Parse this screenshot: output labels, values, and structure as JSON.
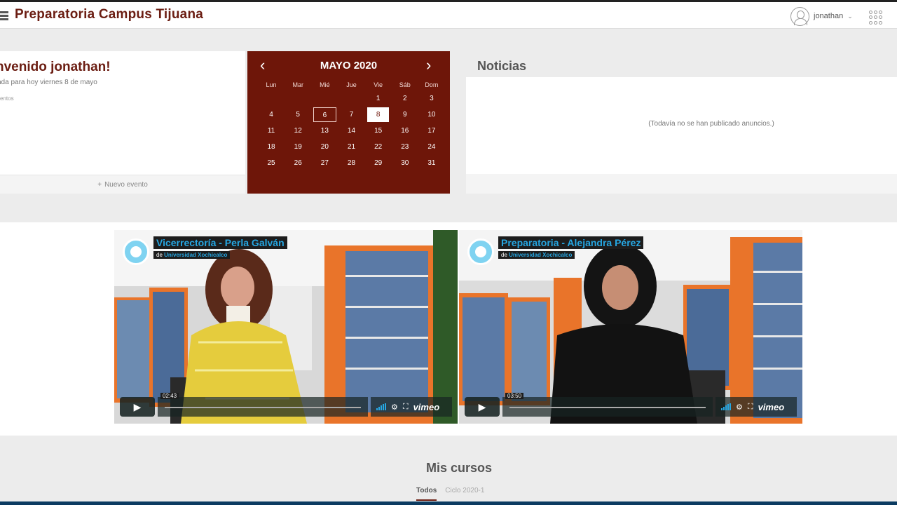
{
  "header": {
    "title": "Preparatoria Campus Tijuana",
    "user": "jonathan",
    "user_chevron": "⌄"
  },
  "welcome": {
    "title": "nvenido jonathan!",
    "subtitle": "nda para hoy viernes 8 de mayo",
    "no_events": "ventos",
    "new_event": "Nuevo evento",
    "new_event_icon": "+"
  },
  "calendar": {
    "title": "MAYO 2020",
    "prev": "‹",
    "next": "›",
    "weekdays": [
      "Lun",
      "Mar",
      "Mié",
      "Jue",
      "Vie",
      "Sáb",
      "Dom"
    ],
    "weeks": [
      [
        "",
        "",
        "",
        "",
        "1",
        "2",
        "3"
      ],
      [
        "4",
        "5",
        "6",
        "7",
        "8",
        "9",
        "10"
      ],
      [
        "11",
        "12",
        "13",
        "14",
        "15",
        "16",
        "17"
      ],
      [
        "18",
        "19",
        "20",
        "21",
        "22",
        "23",
        "24"
      ],
      [
        "25",
        "26",
        "27",
        "28",
        "29",
        "30",
        "31"
      ]
    ],
    "outlined_day": "6",
    "today": "8",
    "color": "#6e1609"
  },
  "news": {
    "title": "Noticias",
    "empty": "(Todavía no se han publicado anuncios.)"
  },
  "videos": [
    {
      "title": "Vicerrectoría - Perla Galván",
      "by_prefix": "de",
      "by": "Universidad Xochicalco",
      "time": "02:43",
      "brand": "vimeo"
    },
    {
      "title": "Preparatoria - Alejandra Pérez",
      "by_prefix": "de",
      "by": "Universidad Xochicalco",
      "time": "03:50",
      "brand": "vimeo"
    }
  ],
  "courses": {
    "title": "Mis cursos",
    "tabs": [
      "Todos",
      "Ciclo 2020-1"
    ]
  },
  "colors": {
    "brand": "#6b1d12",
    "accent": "#26a7e3",
    "footer": "#0b3b61"
  }
}
